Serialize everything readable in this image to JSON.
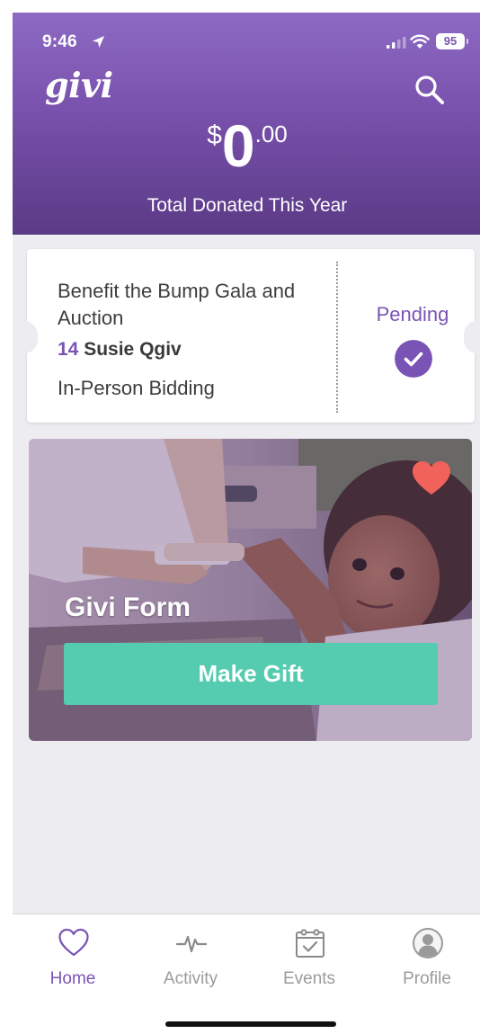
{
  "status_bar": {
    "time": "9:46",
    "battery": "95"
  },
  "header": {
    "logo": "givi",
    "amount": {
      "currency": "$",
      "whole": "0",
      "cents": ".00"
    },
    "total_label": "Total Donated This Year"
  },
  "event_card": {
    "title": "Benefit the Bump Gala and Auction",
    "bidder_number": "14",
    "bidder_name": "Susie Qgiv",
    "mode": "In-Person Bidding",
    "status": "Pending"
  },
  "form_card": {
    "title": "Givi Form",
    "button_label": "Make Gift",
    "favorite": true
  },
  "tab_bar": {
    "tabs": [
      {
        "label": "Home",
        "icon": "heart-outline-icon",
        "active": true
      },
      {
        "label": "Activity",
        "icon": "pulse-icon",
        "active": false
      },
      {
        "label": "Events",
        "icon": "calendar-check-icon",
        "active": false
      },
      {
        "label": "Profile",
        "icon": "user-circle-icon",
        "active": false
      }
    ]
  },
  "colors": {
    "brand_purple": "#7a54b4",
    "header_top": "#8e6ac4",
    "header_bottom": "#5b3a86",
    "button_teal": "#55cbb0",
    "heart_coral": "#f0625a",
    "background": "#ededf1"
  }
}
